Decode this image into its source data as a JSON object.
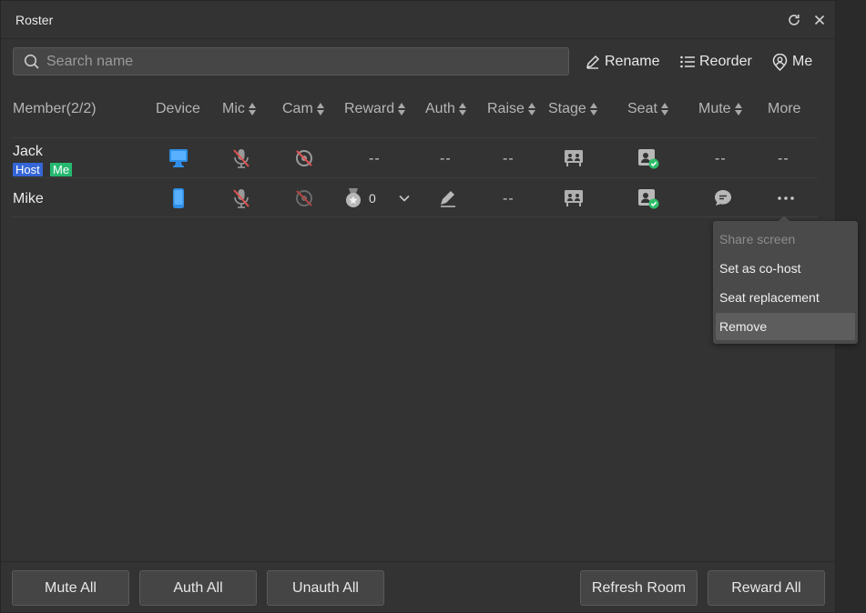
{
  "window": {
    "title": "Roster"
  },
  "search": {
    "placeholder": "Search name"
  },
  "header_actions": {
    "rename": "Rename",
    "reorder": "Reorder",
    "me": "Me"
  },
  "columns": {
    "member": "Member(2/2)",
    "device": "Device",
    "mic": "Mic",
    "cam": "Cam",
    "reward": "Reward",
    "auth": "Auth",
    "raise": "Raise",
    "stage": "Stage",
    "seat": "Seat",
    "mute": "Mute",
    "more": "More"
  },
  "rows": [
    {
      "name": "Jack",
      "badges": [
        "Host",
        "Me"
      ],
      "device": "desktop-icon",
      "mic": "mic-off-icon",
      "cam": "cam-off-icon",
      "reward": "--",
      "auth": "--",
      "raise": "--",
      "stage": "stage-icon",
      "seat": "seat-check-icon",
      "mute": "--",
      "more": "--"
    },
    {
      "name": "Mike",
      "device": "phone-icon",
      "mic": "mic-off-icon",
      "cam": "cam-off-icon",
      "reward_count": "0",
      "auth": "pen-icon",
      "raise": "--",
      "stage": "stage-icon",
      "seat": "seat-check-icon",
      "mute": "chat-bubble-icon",
      "more": "ellipsis-icon"
    }
  ],
  "context_menu": {
    "items": [
      "Share screen",
      "Set as co-host",
      "Seat replacement",
      "Remove"
    ]
  },
  "footer": {
    "mute_all": "Mute All",
    "auth_all": "Auth All",
    "unauth_all": "Unauth All",
    "refresh_room": "Refresh Room",
    "reward_all": "Reward All"
  },
  "colors": {
    "host_badge": "#3565d6",
    "me_badge": "#27b870",
    "device_blue": "#2f8fe8",
    "mic_off_red": "#e05353",
    "seat_check_green": "#2fbf6a"
  }
}
